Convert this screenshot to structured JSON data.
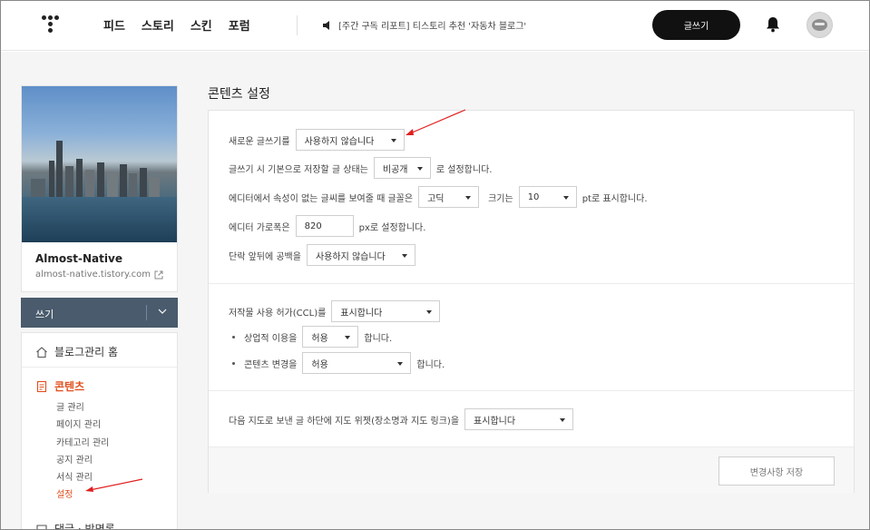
{
  "nav": {
    "links": [
      "피드",
      "스토리",
      "스킨",
      "포럼"
    ],
    "notice": "[주간 구독 리포트] 티스토리 추천 '자동차 블로그'",
    "write_button": "글쓰기"
  },
  "sidebar": {
    "blog_name": "Almost-Native",
    "blog_url": "almost-native.tistory.com",
    "write_bar_label": "쓰기",
    "home_label": "블로그관리 홈",
    "content_label": "콘텐츠",
    "submenu": [
      "글 관리",
      "페이지 관리",
      "카테고리 관리",
      "공지 관리",
      "서식 관리",
      "설정"
    ],
    "next_label": "댓글 · 방명록"
  },
  "main": {
    "title": "콘텐츠 설정",
    "editor": {
      "new_editor_label": "새로운 글쓰기를",
      "new_editor_value": "사용하지 않습니다",
      "default_status_label": "글쓰기 시 기본으로 저장할 글 상태는",
      "default_status_value": "비공개",
      "default_status_suffix": "로 설정합니다.",
      "font_label": "에디터에서 속성이 없는 글씨를 보여줄 때 글꼴은",
      "font_value": "고딕",
      "size_label": "크기는",
      "size_value": "10",
      "size_suffix": "pt로 표시합니다.",
      "width_label": "에디터 가로폭은",
      "width_value": "820",
      "width_suffix": "px로 설정합니다.",
      "spacing_label": "단락 앞뒤에 공백을",
      "spacing_value": "사용하지 않습니다"
    },
    "ccl": {
      "ccl_label": "저작물 사용 허가(CCL)를",
      "ccl_value": "표시합니다",
      "commercial_label": "상업적 이용을",
      "commercial_value": "허용",
      "commercial_suffix": "합니다.",
      "modify_label": "콘텐츠 변경을",
      "modify_value": "허용",
      "modify_suffix": "합니다."
    },
    "map": {
      "label": "다음 지도로 보낸 글 하단에 지도 위젯(장소명과 지도 링크)을",
      "value": "표시합니다"
    },
    "save_button": "변경사항 저장"
  },
  "colors": {
    "accent": "#e0501e",
    "write_bar": "#495b6c",
    "annotation": "#e02020"
  }
}
